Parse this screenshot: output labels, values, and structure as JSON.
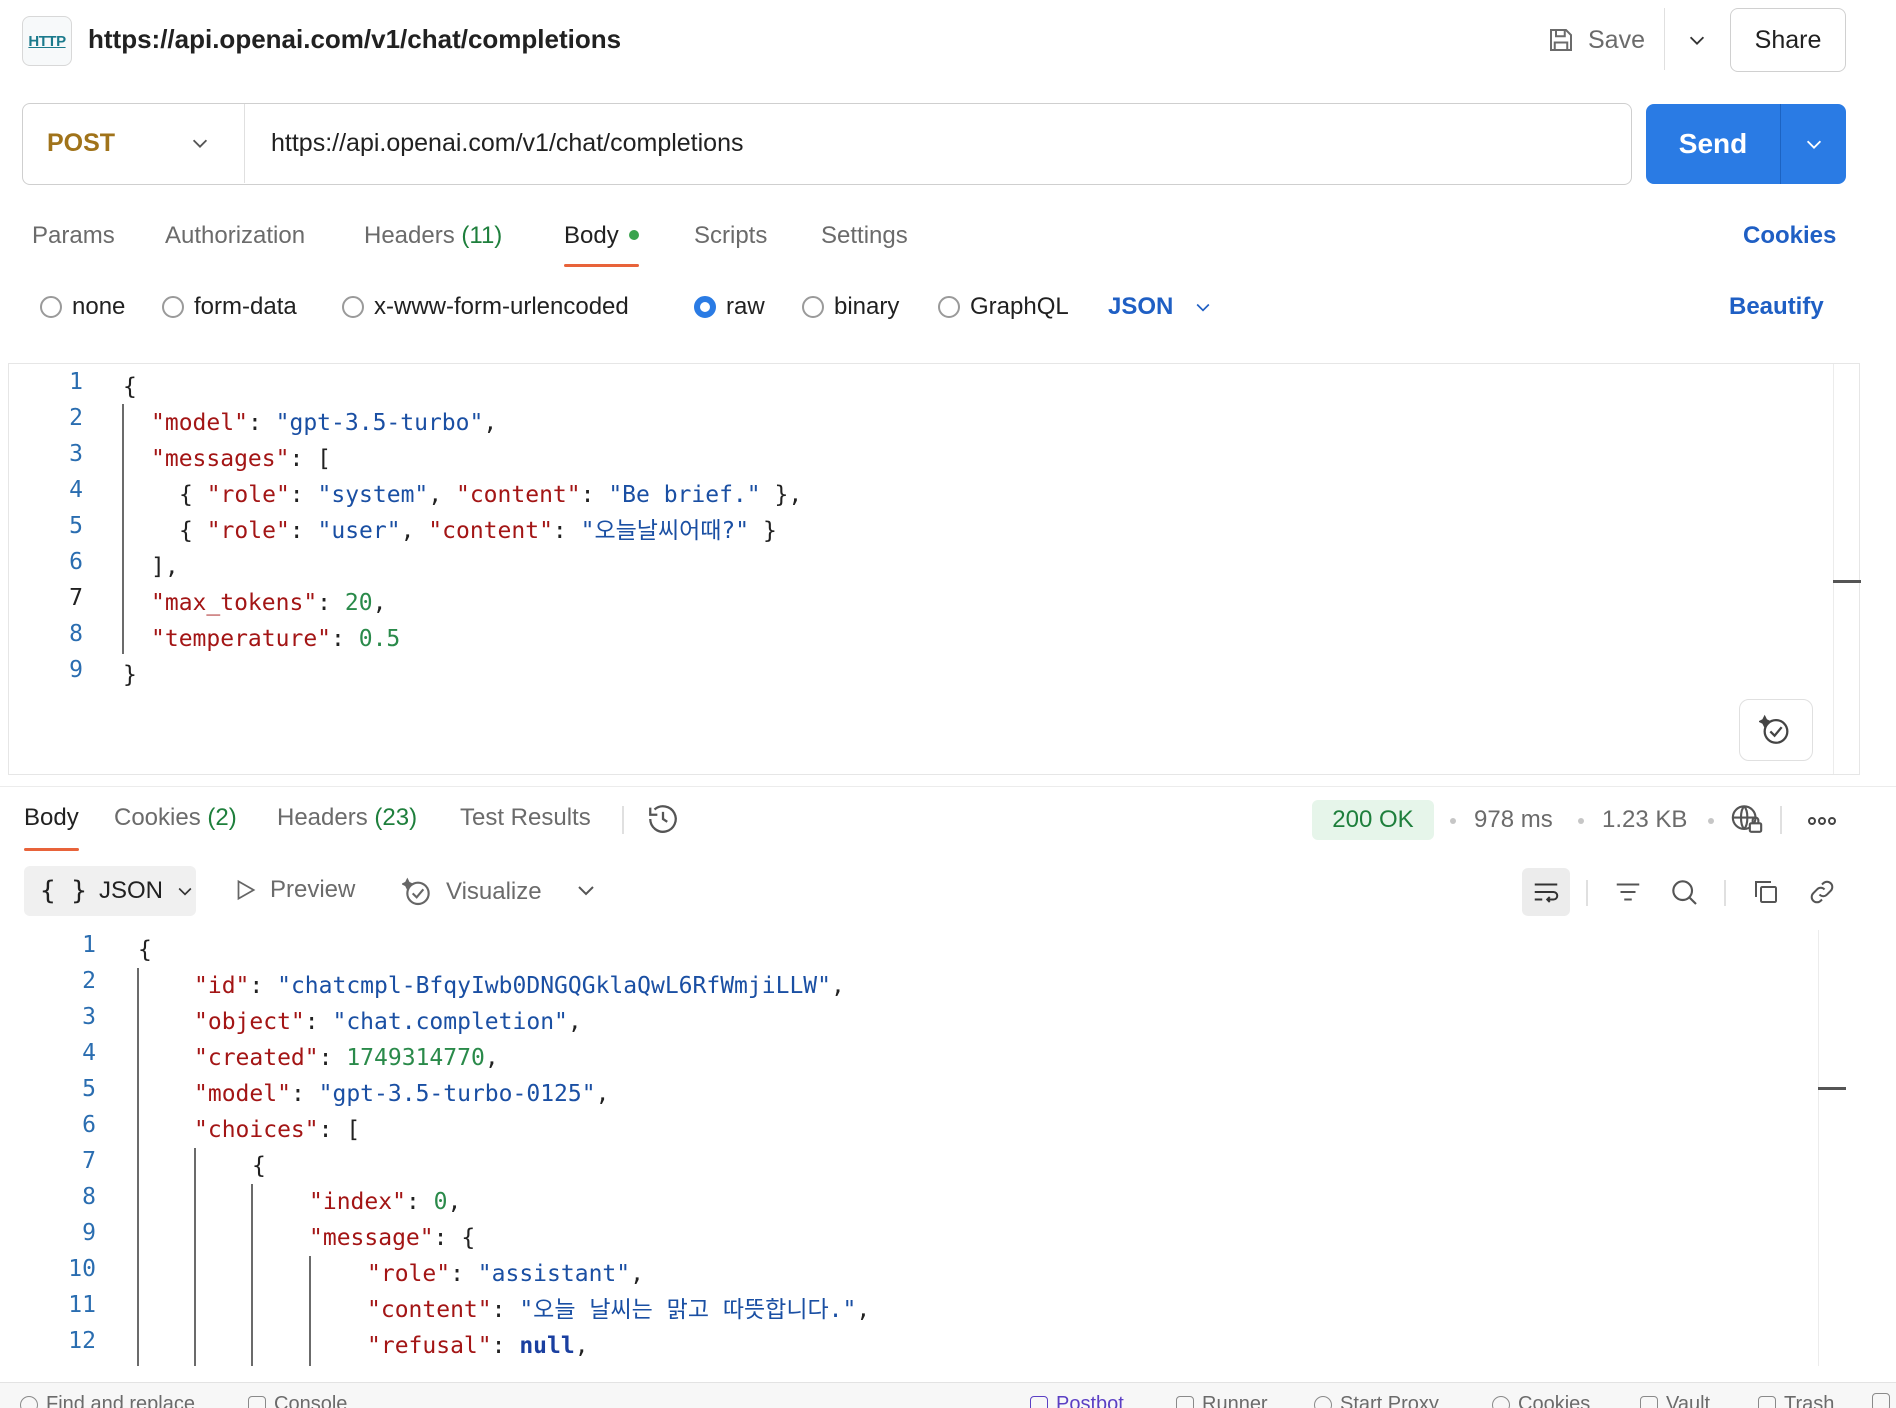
{
  "header": {
    "badge": "HTTP",
    "title": "https://api.openai.com/v1/chat/completions",
    "save_label": "Save",
    "share_label": "Share"
  },
  "request": {
    "method": "POST",
    "url": "https://api.openai.com/v1/chat/completions",
    "send_label": "Send"
  },
  "request_tabs": {
    "params": "Params",
    "authorization": "Authorization",
    "headers": "Headers",
    "headers_count": "(11)",
    "body": "Body",
    "scripts": "Scripts",
    "settings": "Settings",
    "cookies": "Cookies"
  },
  "body_options": {
    "none": "none",
    "form_data": "form-data",
    "urlencoded": "x-www-form-urlencoded",
    "raw": "raw",
    "binary": "binary",
    "graphql": "GraphQL",
    "format": "JSON",
    "beautify": "Beautify",
    "selected": "raw"
  },
  "request_body_lines": [
    {
      "n": "1"
    },
    {
      "n": "2"
    },
    {
      "n": "3"
    },
    {
      "n": "4"
    },
    {
      "n": "5"
    },
    {
      "n": "6"
    },
    {
      "n": "7"
    },
    {
      "n": "8"
    },
    {
      "n": "9"
    }
  ],
  "response_tabs": {
    "body": "Body",
    "cookies": "Cookies",
    "cookies_count": "(2)",
    "headers": "Headers",
    "headers_count": "(23)",
    "test_results": "Test Results",
    "status": "200 OK",
    "time": "978 ms",
    "size": "1.23 KB"
  },
  "response_toolbar": {
    "format": "JSON",
    "preview": "Preview",
    "visualize": "Visualize"
  },
  "response_body_lines": [
    {
      "n": "1"
    },
    {
      "n": "2"
    },
    {
      "n": "3"
    },
    {
      "n": "4"
    },
    {
      "n": "5"
    },
    {
      "n": "6"
    },
    {
      "n": "7"
    },
    {
      "n": "8"
    },
    {
      "n": "9"
    },
    {
      "n": "10"
    },
    {
      "n": "11"
    },
    {
      "n": "12"
    }
  ],
  "code": {
    "req_model_key": "\"model\"",
    "req_model_val": "\"gpt-3.5-turbo\"",
    "req_messages_key": "\"messages\"",
    "req_role_key": "\"role\"",
    "req_system_val": "\"system\"",
    "req_content_key": "\"content\"",
    "req_brief_val": "\"Be brief.\"",
    "req_user_val": "\"user\"",
    "req_korean_val": "\"오늘날씨어때?\"",
    "req_max_tokens_key": "\"max_tokens\"",
    "req_max_tokens_val": "20",
    "req_temperature_key": "\"temperature\"",
    "req_temperature_val": "0.5",
    "resp_id_key": "\"id\"",
    "resp_id_val": "\"chatcmpl-BfqyIwb0DNGQGklaQwL6RfWmjiLLW\"",
    "resp_object_key": "\"object\"",
    "resp_object_val": "\"chat.completion\"",
    "resp_created_key": "\"created\"",
    "resp_created_val": "1749314770",
    "resp_model_key": "\"model\"",
    "resp_model_val": "\"gpt-3.5-turbo-0125\"",
    "resp_choices_key": "\"choices\"",
    "resp_index_key": "\"index\"",
    "resp_index_val": "0",
    "resp_message_key": "\"message\"",
    "resp_role_key": "\"role\"",
    "resp_role_val": "\"assistant\"",
    "resp_content_key": "\"content\"",
    "resp_content_val": "\"오늘 날씨는 맑고 따뜻합니다.\"",
    "resp_refusal_key": "\"refusal\"",
    "resp_refusal_val": "null"
  },
  "footer": {
    "find_replace": "Find and replace",
    "console": "Console",
    "postbot": "Postbot",
    "runner": "Runner",
    "start_proxy": "Start Proxy",
    "cookies": "Cookies",
    "vault": "Vault",
    "trash": "Trash"
  },
  "colors": {
    "accent": "#2a7be4",
    "method": "#a0731a",
    "tab_underline": "#e8633a",
    "status_ok": "#1e7f3c",
    "link": "#1f5fc4"
  }
}
